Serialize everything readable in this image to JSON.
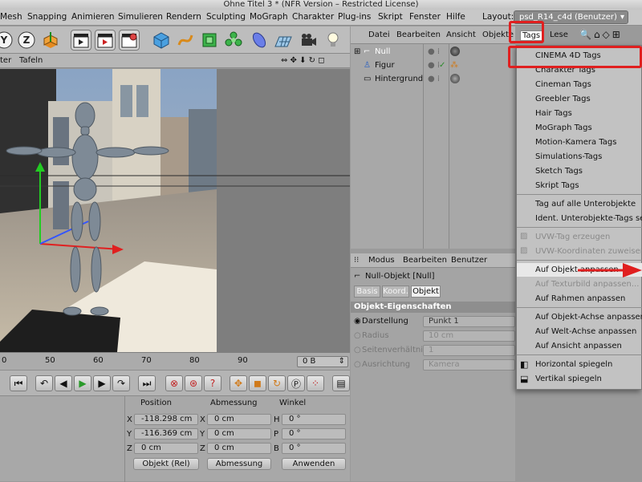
{
  "window": {
    "title": "Ohne Titel 3 * (NFR Version – Restricted License)"
  },
  "menubar": {
    "items": [
      "Mesh",
      "Snapping",
      "Animieren",
      "Simulieren",
      "Rendern",
      "Sculpting",
      "MoGraph",
      "Charakter",
      "Plug-ins",
      "Skript",
      "Fenster",
      "Hilfe"
    ],
    "layout_label": "Layout:",
    "layout_value": "psd_R14_c4d (Benutzer)"
  },
  "viewport_menu": {
    "items": [
      "ter",
      "Tafeln"
    ]
  },
  "object_manager": {
    "menu": [
      "Datei",
      "Bearbeiten",
      "Ansicht",
      "Objekte",
      "Tags",
      "Lese"
    ],
    "objects": [
      {
        "name": "Null"
      },
      {
        "name": "Figur"
      },
      {
        "name": "Hintergrund"
      }
    ]
  },
  "attribute_manager": {
    "menu": [
      "Modus",
      "Bearbeiten",
      "Benutzer"
    ],
    "object_title": "Null-Objekt [Null]",
    "tabs": [
      "Basis",
      "Koord.",
      "Objekt"
    ],
    "section_title": "Objekt-Eigenschaften",
    "props": [
      {
        "label": "Darstellung",
        "value": "Punkt 1"
      },
      {
        "label": "Radius",
        "value": "10 cm"
      },
      {
        "label": "Seitenverhältnis",
        "value": "1"
      },
      {
        "label": "Ausrichtung",
        "value": "Kamera"
      }
    ]
  },
  "tags_menu": {
    "items": [
      {
        "label": "CINEMA 4D Tags",
        "disabled": false
      },
      {
        "label": "Charakter Tags",
        "disabled": false
      },
      {
        "label": "Cineman Tags",
        "disabled": false
      },
      {
        "label": "Greebler Tags",
        "disabled": false
      },
      {
        "label": "Hair Tags",
        "disabled": false
      },
      {
        "label": "MoGraph Tags",
        "disabled": false
      },
      {
        "label": "Motion-Kamera Tags",
        "disabled": false
      },
      {
        "label": "Simulations-Tags",
        "disabled": false
      },
      {
        "label": "Sketch Tags",
        "disabled": false
      },
      {
        "label": "Skript Tags",
        "disabled": false
      },
      {
        "label": "Tag auf alle Unterobjekte",
        "disabled": false
      },
      {
        "label": "Ident. Unterobjekte-Tags selektieren",
        "disabled": false
      },
      {
        "label": "UVW-Tag erzeugen",
        "disabled": true
      },
      {
        "label": "UVW-Koordinaten zuweisen",
        "disabled": true
      },
      {
        "label": "Auf Objekt anpassen",
        "disabled": false
      },
      {
        "label": "Auf Texturbild anpassen...",
        "disabled": true
      },
      {
        "label": "Auf Rahmen anpassen",
        "disabled": false
      },
      {
        "label": "Auf Objekt-Achse anpassen",
        "disabled": false
      },
      {
        "label": "Auf Welt-Achse anpassen",
        "disabled": false
      },
      {
        "label": "Auf Ansicht anpassen",
        "disabled": false
      },
      {
        "label": "Horizontal spiegeln",
        "disabled": false
      },
      {
        "label": "Vertikal spiegeln",
        "disabled": false
      }
    ]
  },
  "timeline": {
    "ticks": [
      "50",
      "60",
      "70",
      "80",
      "90"
    ],
    "current_frame": "0 B"
  },
  "coordinates": {
    "headers": [
      "Position",
      "Abmessung",
      "Winkel"
    ],
    "axes_pos": [
      "X",
      "Y",
      "Z"
    ],
    "axes_rot": [
      "H",
      "P",
      "B"
    ],
    "position": [
      "-118.298 cm",
      "-116.369 cm",
      "0 cm"
    ],
    "size": [
      "0 cm",
      "0 cm",
      "0 cm"
    ],
    "rotation": [
      "0 °",
      "0 °",
      "0 °"
    ],
    "mode_select": "Objekt (Rel)",
    "size_select": "Abmessung",
    "apply_button": "Anwenden"
  },
  "colors": {
    "highlight_red": "#e01f1f",
    "selection_blue": "#3a6cc4"
  }
}
